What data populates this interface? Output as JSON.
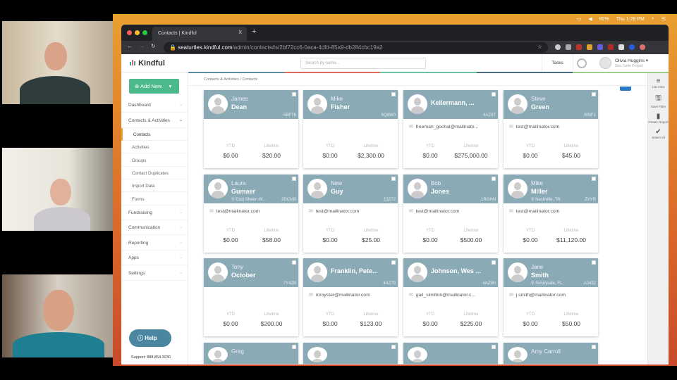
{
  "menubar": {
    "battery": "82%",
    "clock": "Thu 1:28 PM"
  },
  "browser": {
    "tab_title": "Contacts | Kindful",
    "tab_close": "X",
    "new_tab": "+",
    "url_host": "seaturtles.kindful.com",
    "url_path": "/admin/contacts#s/2bf72cc6-0aca-4dfd-85a9-db284cbc19a2"
  },
  "header": {
    "logo": "Kindful",
    "search_placeholder": "Search by name...",
    "tasks": "Tasks",
    "user_name": "Olivia Huggins",
    "user_org": "Sea Turtle Project"
  },
  "stripe_colors": [
    "#5b8fa3",
    "#e06a5a",
    "#6cc4a0",
    "#4a6e80",
    "#9bd08a"
  ],
  "sidebar": {
    "add_new": "Add New",
    "items": [
      {
        "label": "Dashboard",
        "type": "top"
      },
      {
        "label": "Contacts & Activities",
        "type": "top",
        "open": true
      },
      {
        "label": "Contacts",
        "type": "sub",
        "active": true
      },
      {
        "label": "Activities",
        "type": "sub"
      },
      {
        "label": "Groups",
        "type": "sub"
      },
      {
        "label": "Contact Duplicates",
        "type": "sub"
      },
      {
        "label": "Import Data",
        "type": "sub"
      },
      {
        "label": "Forms",
        "type": "sub"
      },
      {
        "label": "Fundraising",
        "type": "top"
      },
      {
        "label": "Communication",
        "type": "top"
      },
      {
        "label": "Reporting",
        "type": "top"
      },
      {
        "label": "Apps",
        "type": "top"
      },
      {
        "label": "Settings",
        "type": "top"
      }
    ],
    "help": "Help",
    "support": "Support: 888.854.3230"
  },
  "breadcrumb": "Contacts & Activities / Contacts",
  "right_tools": [
    "List View",
    "Save Filter",
    "Create Report",
    "Select All"
  ],
  "labels": {
    "ytd": "YTD",
    "lifetime": "Lifetime"
  },
  "contacts": [
    {
      "first": "James",
      "last": "Dean",
      "id": "5BFT6",
      "email": "",
      "location": "",
      "ytd": "$0.00",
      "lifetime": "$20.00"
    },
    {
      "first": "Mike",
      "last": "Fisher",
      "id": "6Q8W0",
      "email": "",
      "location": "",
      "ytd": "$0.00",
      "lifetime": "$2,300.00"
    },
    {
      "name": "Kellermann, ...",
      "id": "4AZ9T",
      "email": "freeman_gochal@mailinato...",
      "location": "",
      "ytd": "$0.00",
      "lifetime": "$275,000.00"
    },
    {
      "first": "Steve",
      "last": "Green",
      "id": "WNF1",
      "email": "test@mailinator.com",
      "location": "",
      "ytd": "$0.00",
      "lifetime": "$45.00"
    },
    {
      "first": "Laura",
      "last": "Gumaer",
      "id": "2DCMB",
      "email": "test@mailinator.com",
      "location": "East Sheen W...",
      "ytd": "$0.00",
      "lifetime": "$58.00"
    },
    {
      "first": "New",
      "last": "Guy",
      "id": "13Z72",
      "email": "test@mailinator.com",
      "location": "",
      "ytd": "$0.00",
      "lifetime": "$25.00"
    },
    {
      "first": "Bob",
      "last": "Jones",
      "id": "1RGHN",
      "email": "test@mailinator.com",
      "location": "",
      "ytd": "$0.00",
      "lifetime": "$500.00"
    },
    {
      "first": "Mike",
      "last": "Miller",
      "id": "ZVYR",
      "email": "test@mailinator.com",
      "location": "Nashville, TN",
      "ytd": "$0.00",
      "lifetime": "$11,120.00"
    },
    {
      "first": "Tony",
      "last": "October",
      "id": "7Y4ZB",
      "email": "",
      "location": "",
      "ytd": "$0.00",
      "lifetime": "$200.00"
    },
    {
      "name": "Franklin, Pete...",
      "id": "4AZ79",
      "email": "mroyster@mailinator.com",
      "location": "",
      "ytd": "$0.00",
      "lifetime": "$123.00"
    },
    {
      "name": "Johnson, Wes ...",
      "id": "4AZ9H",
      "email": "gail_similton@mailinator.c...",
      "location": "",
      "ytd": "$0.00",
      "lifetime": "$225.00"
    },
    {
      "first": "Jane",
      "last": "Smith",
      "id": "A3432",
      "email": "j.smith@mailinator.com",
      "location": "Sunnyvale, FL",
      "ytd": "$0.00",
      "lifetime": "$50.00"
    },
    {
      "first": "Greg",
      "last": "",
      "id": "",
      "email": "",
      "location": "",
      "ytd": "",
      "lifetime": ""
    },
    {
      "first": "",
      "last": "",
      "id": "",
      "email": "",
      "location": "",
      "ytd": "",
      "lifetime": ""
    },
    {
      "first": "",
      "last": "",
      "id": "",
      "email": "",
      "location": "",
      "ytd": "",
      "lifetime": ""
    },
    {
      "name": "Amy Carroll",
      "id": "",
      "email": "",
      "location": "",
      "ytd": "",
      "lifetime": ""
    }
  ]
}
